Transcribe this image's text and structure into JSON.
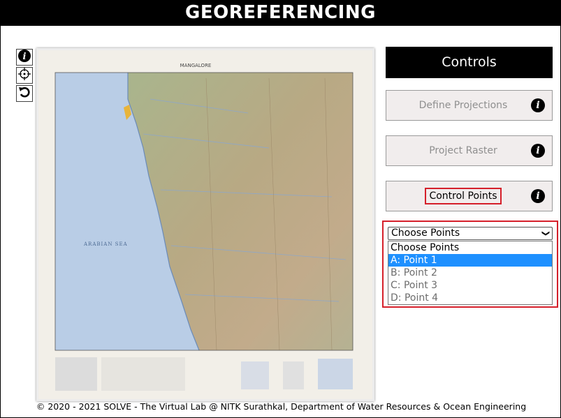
{
  "header": {
    "title": "GEOREFERENCING"
  },
  "toolbar": {
    "items": [
      {
        "name": "info",
        "icon": "info-icon"
      },
      {
        "name": "crosshair",
        "icon": "crosshair-icon"
      },
      {
        "name": "reset",
        "icon": "rotate-ccw-icon"
      }
    ]
  },
  "map": {
    "title": "MANGALORE",
    "sea_label": "ARABIAN SEA"
  },
  "controls": {
    "title": "Controls",
    "buttons": [
      {
        "label": "Define Projections",
        "state": "disabled"
      },
      {
        "label": "Project Raster",
        "state": "disabled"
      },
      {
        "label": "Control Points",
        "state": "active"
      }
    ],
    "info_glyph": "i"
  },
  "points_select": {
    "value": "Choose Points",
    "options": [
      "Choose Points",
      "A: Point 1",
      "B: Point 2",
      "C: Point 3",
      "D: Point 4"
    ],
    "highlighted": "A: Point 1"
  },
  "footer": {
    "text": "© 2020 - 2021 SOLVE - The Virtual Lab @ NITK Surathkal, Department of Water Resources & Ocean Engineering"
  },
  "colors": {
    "header_bg": "#000000",
    "highlight": "#d51f2a",
    "selected_option": "#1e90ff",
    "button_bg": "#f1eded"
  }
}
